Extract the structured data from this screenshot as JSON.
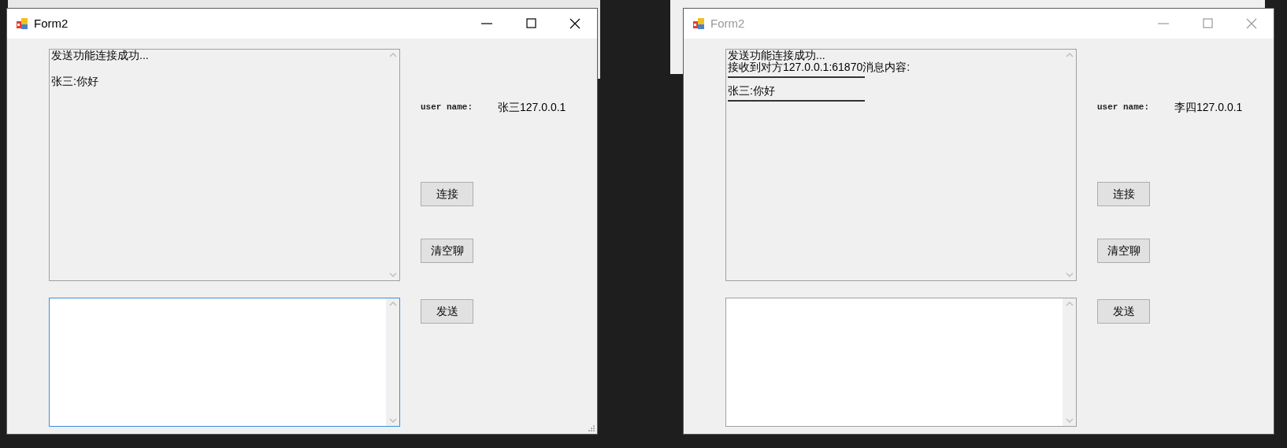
{
  "windows": [
    {
      "title": "Form2",
      "active": true,
      "chat_log": [
        {
          "text": "发送功能连接成功...",
          "rule_below": false
        },
        {
          "text": "张三:你好",
          "rule_below": false
        }
      ],
      "message_field": {
        "focused": true
      },
      "user_name_label": "user name:",
      "user_name_value": "张三127.0.0.1",
      "buttons": [
        "连接",
        "清空聊",
        "发送"
      ]
    },
    {
      "title": "Form2",
      "active": false,
      "chat_log": [
        {
          "text": "发送功能连接成功...",
          "rule_below": false
        },
        {
          "text": "接收到对方127.0.0.1:61870消息内容:",
          "rule_below": true
        },
        {
          "text": "张三:你好",
          "rule_below": true
        }
      ],
      "message_field": {
        "focused": false
      },
      "user_name_label": "user name:",
      "user_name_value": "李四127.0.0.1",
      "buttons": [
        "连接",
        "清空聊",
        "发送"
      ]
    }
  ]
}
